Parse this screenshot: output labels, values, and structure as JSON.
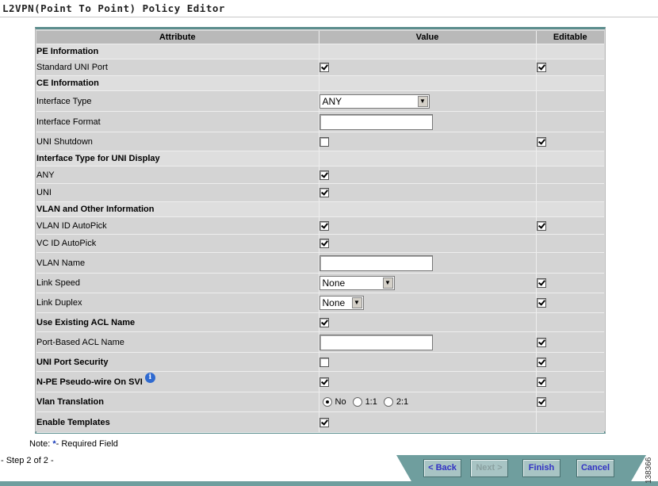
{
  "page": {
    "title": "L2VPN(Point To Point) Policy Editor"
  },
  "table": {
    "headers": {
      "attribute": "Attribute",
      "value": "Value",
      "editable": "Editable"
    },
    "rows": [
      {
        "kind": "section",
        "label": "PE Information"
      },
      {
        "kind": "row",
        "label": "Standard UNI Port",
        "value_type": "checkbox",
        "value": true,
        "editable": true
      },
      {
        "kind": "section",
        "label": "CE Information"
      },
      {
        "kind": "row",
        "label": "Interface Type",
        "value_type": "select",
        "value": "ANY",
        "editable": null
      },
      {
        "kind": "row",
        "label": "Interface Format",
        "value_type": "text",
        "value": "",
        "editable": null
      },
      {
        "kind": "row",
        "label": "UNI Shutdown",
        "value_type": "checkbox",
        "value": false,
        "editable": true
      },
      {
        "kind": "section",
        "label": "Interface Type for UNI Display"
      },
      {
        "kind": "row",
        "label": "ANY",
        "value_type": "checkbox",
        "value": true,
        "editable": null
      },
      {
        "kind": "row",
        "label": "UNI",
        "value_type": "checkbox",
        "value": true,
        "editable": null
      },
      {
        "kind": "section",
        "label": "VLAN and Other Information"
      },
      {
        "kind": "row",
        "label": "VLAN ID AutoPick",
        "value_type": "checkbox",
        "value": true,
        "editable": true
      },
      {
        "kind": "row",
        "label": "VC ID AutoPick",
        "value_type": "checkbox",
        "value": true,
        "editable": null
      },
      {
        "kind": "row",
        "label": "VLAN Name",
        "value_type": "text",
        "value": "",
        "editable": null
      },
      {
        "kind": "row",
        "label": "Link Speed",
        "value_type": "select",
        "value": "None",
        "editable": true
      },
      {
        "kind": "row",
        "label": "Link Duplex",
        "value_type": "select",
        "value": "None",
        "editable": true
      },
      {
        "kind": "boldrow",
        "label": "Use Existing ACL Name",
        "value_type": "checkbox",
        "value": true,
        "editable": null
      },
      {
        "kind": "row",
        "label": "Port-Based ACL Name",
        "value_type": "text",
        "value": "",
        "editable": true
      },
      {
        "kind": "boldrow-indent",
        "label": "UNI Port Security",
        "value_type": "checkbox",
        "value": false,
        "editable": true
      },
      {
        "kind": "boldrow-indent",
        "label": "N-PE Pseudo-wire On SVI",
        "value_type": "checkbox",
        "value": true,
        "editable": true,
        "info": true
      },
      {
        "kind": "boldrow",
        "label": "Vlan Translation",
        "value_type": "radio",
        "options": [
          "No",
          "1:1",
          "2:1"
        ],
        "value": "No",
        "editable": true
      },
      {
        "kind": "boldrow-indent",
        "label": "Enable Templates",
        "value_type": "checkbox",
        "value": true,
        "editable": null
      }
    ]
  },
  "footer": {
    "note_prefix": "Note: ",
    "note_star": "*",
    "note_suffix": "- Required Field",
    "step": "- Step 2 of 2 -",
    "side_number": "138366"
  },
  "buttons": {
    "back": "< Back",
    "next": "Next >",
    "finish": "Finish",
    "cancel": "Cancel"
  },
  "colors": {
    "accent": "#6f9e9e",
    "button_text": "#3232c4"
  }
}
